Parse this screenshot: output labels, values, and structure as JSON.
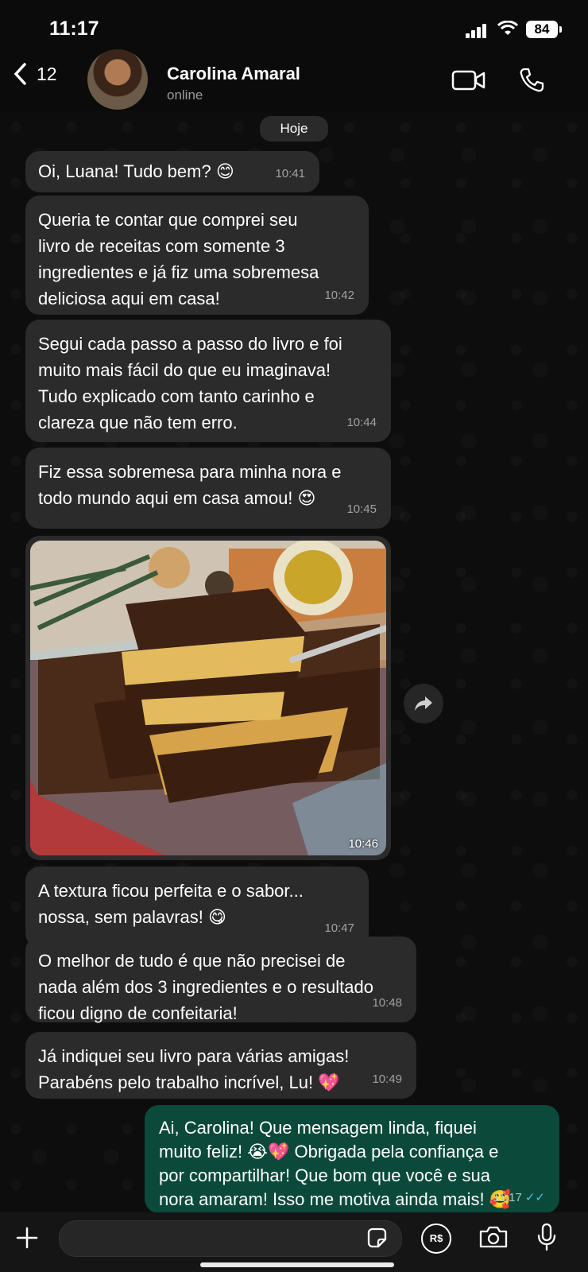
{
  "status_bar": {
    "time": "11:17",
    "battery": "84"
  },
  "header": {
    "back_count": "12",
    "contact_name": "Carolina Amaral",
    "contact_status": "online"
  },
  "chat": {
    "date_chip": "Hoje",
    "messages": [
      {
        "text": "Oi, Luana! Tudo bem? 😊",
        "time": "10:41"
      },
      {
        "text": "Queria te contar que comprei seu\nlivro de receitas com somente 3\ningredientes e já fiz uma sobremesa\ndeliciosa aqui em casa!",
        "time": "10:42"
      },
      {
        "text": "Segui cada passo a passo do livro e foi\nmuito mais fácil do que eu imaginava!\nTudo explicado com tanto carinho e\nclareza que não tem erro.",
        "time": "10:44"
      },
      {
        "text": "Fiz essa sobremesa para minha nora e\ntodo mundo aqui em casa amou! 😍",
        "time": "10:45"
      },
      {
        "image_time": "10:46"
      },
      {
        "text": "A textura ficou perfeita e o sabor...\nnossa, sem palavras! 😋",
        "time": "10:47"
      },
      {
        "text": "O melhor de tudo é que não precisei de\nnada além dos 3 ingredientes e o resultado\nficou digno de confeitaria!",
        "time": "10:48"
      },
      {
        "text": "Já indiquei seu livro para várias amigas!\nParabéns pelo trabalho incrível, Lu! 💖",
        "time": "10:49"
      }
    ],
    "outgoing": {
      "text": "Ai, Carolina! Que mensagem linda, fiquei\nmuito feliz! 😭💖 Obrigada pela confiança e\npor compartilhar! Que bom que você e sua\nnora amaram! Isso me motiva ainda mais! 🥰",
      "time": "11:17"
    }
  },
  "input_bar": {
    "pay_label": "R$"
  },
  "colors": {
    "incoming": "#2b2b2b",
    "outgoing": "#0b4a3a",
    "read_ticks": "#53bdeb"
  }
}
